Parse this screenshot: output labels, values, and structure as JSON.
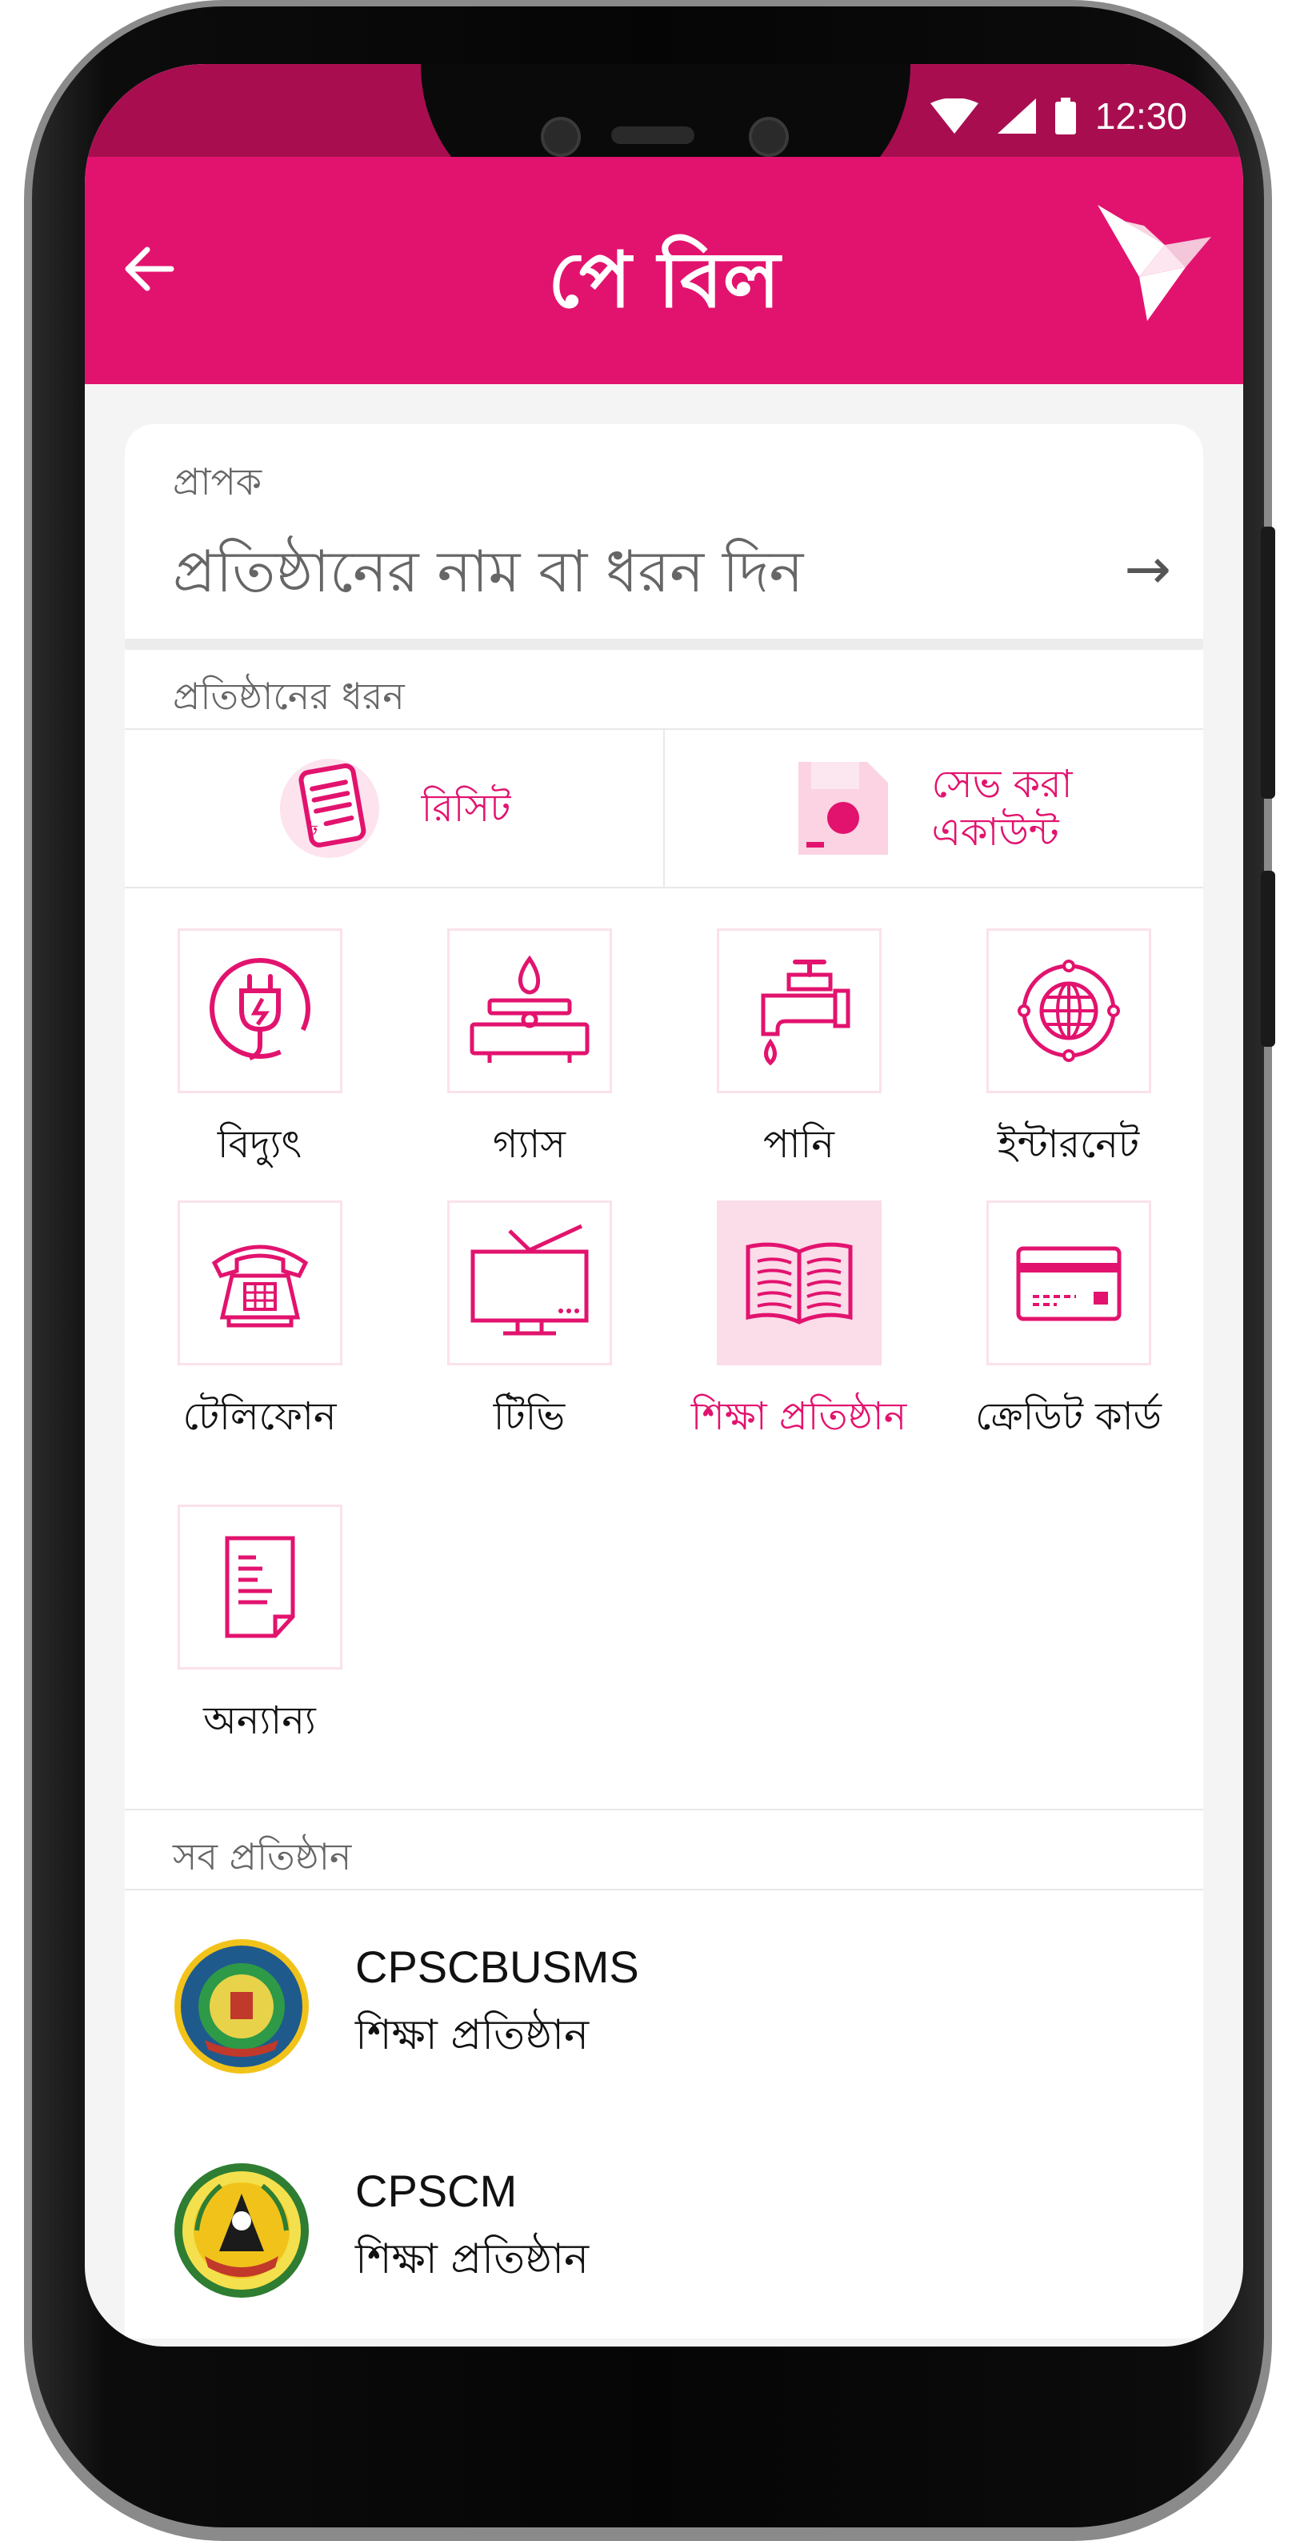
{
  "status_bar": {
    "time": "12:30"
  },
  "app_bar": {
    "title": "পে বিল"
  },
  "recipient": {
    "label": "প্রাপক",
    "placeholder": "প্রতিষ্ঠানের নাম বা ধরন দিন"
  },
  "org_type_section": {
    "label": "প্রতিষ্ঠানের ধরন"
  },
  "quick_actions": [
    {
      "label": "রিসিট",
      "icon": "receipt-icon"
    },
    {
      "label_line1": "সেভ করা",
      "label_line2": "একাউন্ট",
      "icon": "saved-account-icon"
    }
  ],
  "categories": [
    {
      "label": "বিদ্যুৎ",
      "icon": "electricity-icon"
    },
    {
      "label": "গ্যাস",
      "icon": "gas-stove-icon"
    },
    {
      "label": "পানি",
      "icon": "water-tap-icon"
    },
    {
      "label": "ইন্টারনেট",
      "icon": "internet-globe-icon"
    },
    {
      "label": "টেলিফোন",
      "icon": "telephone-icon"
    },
    {
      "label": "টিভি",
      "icon": "tv-icon"
    },
    {
      "label": "শিক্ষা প্রতিষ্ঠান",
      "icon": "book-icon",
      "selected": true
    },
    {
      "label": "ক্রেডিট কার্ড",
      "icon": "credit-card-icon"
    },
    {
      "label": "অন্যান্য",
      "icon": "document-icon"
    }
  ],
  "all_orgs_section": {
    "label": "সব প্রতিষ্ঠান"
  },
  "organizations": [
    {
      "name": "CPSCBUSMS",
      "type": "শিক্ষা প্রতিষ্ঠান"
    },
    {
      "name": "CPSCM",
      "type": "শিক্ষা প্রতিষ্ঠান"
    }
  ],
  "colors": {
    "brand": "#e2136e",
    "status_bar": "#a80e4f",
    "tile_border": "#fbe1ec",
    "tile_selected": "#fbdce9"
  }
}
